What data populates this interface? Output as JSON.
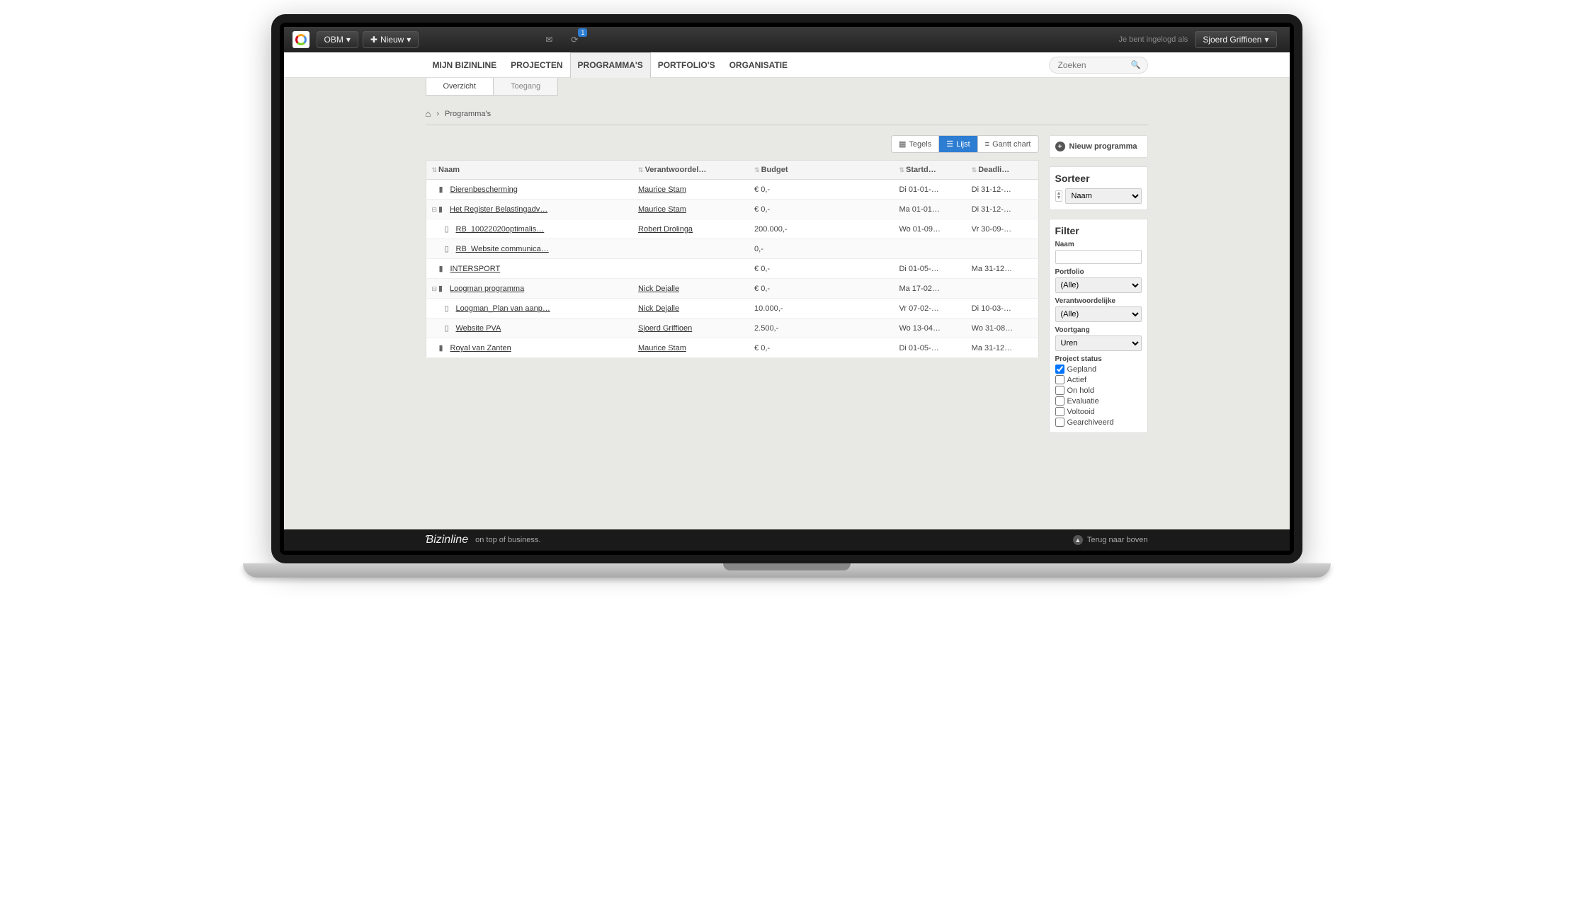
{
  "topbar": {
    "org": "OBM",
    "new": "Nieuw",
    "badge": "1",
    "logged_in_as": "Je bent ingelogd als",
    "user": "Sjoerd Griffioen"
  },
  "nav": {
    "items": [
      "MIJN BIZINLINE",
      "PROJECTEN",
      "PROGRAMMA'S",
      "PORTFOLIO'S",
      "ORGANISATIE"
    ],
    "search_placeholder": "Zoeken"
  },
  "subtabs": {
    "overview": "Overzicht",
    "access": "Toegang"
  },
  "breadcrumb": {
    "current": "Programma's"
  },
  "view_toolbar": {
    "tiles": "Tegels",
    "list": "Lijst",
    "gantt": "Gantt chart"
  },
  "table": {
    "headers": {
      "naam": "Naam",
      "verant": "Verantwoordel…",
      "budget": "Budget",
      "start": "Startd…",
      "deadline": "Deadli…"
    },
    "rows": [
      {
        "type": "prog",
        "naam": "Dierenbescherming",
        "verant": "Maurice Stam",
        "budget": "€ 0,-",
        "start": "Di 01-01-…",
        "deadline": "Di 31-12-…"
      },
      {
        "type": "prog",
        "expand": true,
        "naam": "Het Register Belastingadv…",
        "verant": "Maurice Stam",
        "budget": "€ 0,-",
        "start": "Ma 01-01…",
        "deadline": "Di 31-12-…"
      },
      {
        "type": "sub",
        "naam": "RB_10022020optimalis…",
        "verant": "Robert Drolinga",
        "budget": "200.000,-",
        "start": "Wo 01-09…",
        "deadline": "Vr 30-09-…"
      },
      {
        "type": "sub",
        "naam": "RB_Website communica…",
        "verant": "",
        "budget": "0,-",
        "start": "",
        "deadline": ""
      },
      {
        "type": "prog",
        "naam": "INTERSPORT",
        "verant": "",
        "budget": "€ 0,-",
        "start": "Di 01-05-…",
        "deadline": "Ma 31-12…"
      },
      {
        "type": "prog",
        "expand": true,
        "naam": "Loogman programma",
        "verant": "Nick Dejalle",
        "budget": "€ 0,-",
        "start": "Ma 17-02…",
        "deadline": ""
      },
      {
        "type": "sub",
        "naam": "Loogman_Plan van aanp…",
        "verant": "Nick Dejalle",
        "budget": "10.000,-",
        "start": "Vr 07-02-…",
        "deadline": "Di 10-03-…"
      },
      {
        "type": "sub",
        "naam": "Website PVA",
        "verant": "Sjoerd Griffioen",
        "budget": "2.500,-",
        "start": "Wo 13-04…",
        "deadline": "Wo 31-08…"
      },
      {
        "type": "prog",
        "naam": "Royal van Zanten",
        "verant": "Maurice Stam",
        "budget": "€ 0,-",
        "start": "Di 01-05-…",
        "deadline": "Ma 31-12…"
      }
    ]
  },
  "sidebar": {
    "new_programma": "Nieuw programma",
    "sort_heading": "Sorteer",
    "sort_value": "Naam",
    "filter_heading": "Filter",
    "labels": {
      "naam": "Naam",
      "portfolio": "Portfolio",
      "verant": "Verantwoordelijke",
      "voortgang": "Voortgang",
      "status": "Project status"
    },
    "portfolio_value": "(Alle)",
    "verant_value": "(Alle)",
    "voortgang_value": "Uren",
    "status_options": [
      {
        "label": "Gepland",
        "checked": true
      },
      {
        "label": "Actief",
        "checked": false
      },
      {
        "label": "On hold",
        "checked": false
      },
      {
        "label": "Evaluatie",
        "checked": false
      },
      {
        "label": "Voltooid",
        "checked": false
      },
      {
        "label": "Gearchiveerd",
        "checked": false
      }
    ]
  },
  "footer": {
    "brand": "Ɓizinline",
    "tagline": "on top of business.",
    "back_to_top": "Terug naar boven"
  }
}
